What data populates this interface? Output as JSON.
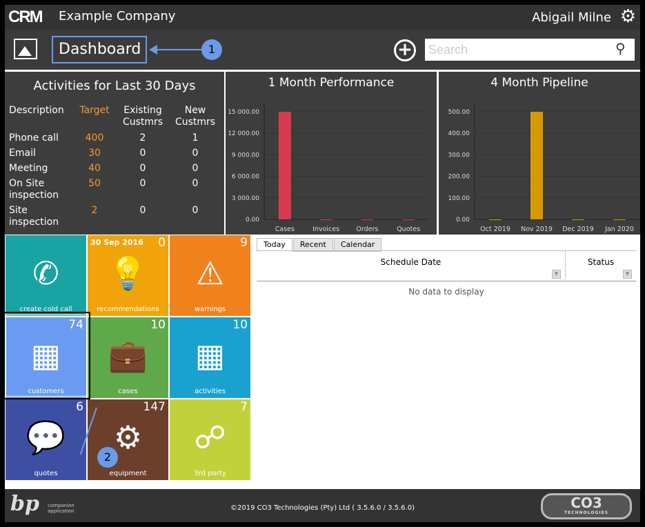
{
  "header": {
    "logo": "CRM",
    "company": "Example Company",
    "user": "Abigail Milne",
    "page_title": "Dashboard",
    "search_placeholder": "Search",
    "callout1": "1",
    "callout2": "2"
  },
  "activities": {
    "title": "Activities for Last 30 Days",
    "columns": [
      "Description",
      "Target",
      "Existing Custmrs",
      "New Custmrs"
    ],
    "rows": [
      [
        "Phone call",
        "400",
        "2",
        "1"
      ],
      [
        "Email",
        "30",
        "0",
        "0"
      ],
      [
        "Meeting",
        "40",
        "0",
        "0"
      ],
      [
        "On Site inspection",
        "50",
        "0",
        "0"
      ],
      [
        "Site inspection",
        "2",
        "0",
        "0"
      ]
    ]
  },
  "chart_data": [
    {
      "type": "bar",
      "title": "1 Month Performance",
      "categories": [
        "Cases",
        "Invoices",
        "Orders",
        "Quotes"
      ],
      "values": [
        15000,
        0,
        0,
        0
      ],
      "yticks": [
        "0.00",
        "3 000.00",
        "6 000.00",
        "9 000.00",
        "12 000.00",
        "15 000.00"
      ],
      "ylim": [
        0,
        15000
      ],
      "color": "#d83a50",
      "grid": true
    },
    {
      "type": "bar",
      "title": "4 Month Pipeline",
      "categories": [
        "Oct 2019",
        "Nov 2019",
        "Dec 2019",
        "Jan 2020"
      ],
      "values": [
        0,
        500,
        0,
        0
      ],
      "yticks": [
        "0.00",
        "100.00",
        "200.00",
        "300.00",
        "400.00",
        "500.00"
      ],
      "ylim": [
        0,
        500
      ],
      "color": "#d69a00",
      "grid": true
    }
  ],
  "tiles": [
    {
      "label": "create cold call",
      "count": "",
      "icon": "phone-icon",
      "glyph": "✆",
      "color": "#1aa3a3"
    },
    {
      "label": "recommendations",
      "count": "0",
      "date": "30 Sep 2016",
      "icon": "lightbulb-icon",
      "glyph": "💡",
      "color": "#f0a30a"
    },
    {
      "label": "warnings",
      "count": "9",
      "icon": "warning-icon",
      "glyph": "⚠",
      "color": "#f0821e"
    },
    {
      "label": "customers",
      "count": "74",
      "icon": "building-icon",
      "glyph": "▦",
      "color": "#6a9bf0"
    },
    {
      "label": "cases",
      "count": "10",
      "icon": "briefcase-icon",
      "glyph": "💼",
      "color": "#60a94b"
    },
    {
      "label": "activities",
      "count": "10",
      "icon": "calendar-icon",
      "glyph": "▦",
      "color": "#1ba1d0"
    },
    {
      "label": "quotes",
      "count": "6",
      "icon": "chat-icon",
      "glyph": "💬",
      "color": "#3e4ea3"
    },
    {
      "label": "equipment",
      "count": "147",
      "icon": "gears-icon",
      "glyph": "⚙",
      "color": "#6b3f2a"
    },
    {
      "label": "3rd party",
      "count": "7",
      "icon": "share-icon",
      "glyph": "☍",
      "color": "#c1d13c"
    }
  ],
  "schedule": {
    "tabs": [
      "Today",
      "Recent",
      "Calendar"
    ],
    "columns": [
      "Schedule Date",
      "Status"
    ],
    "empty": "No data to display"
  },
  "footer": {
    "copyright": "©2019 CO3 Technologies (Pty) Ltd ( 3.5.6.0 / 3.5.6.0)",
    "bp_logo": "a bp companion application",
    "co3_logo": "CO3 TECHNOLOGIES"
  }
}
